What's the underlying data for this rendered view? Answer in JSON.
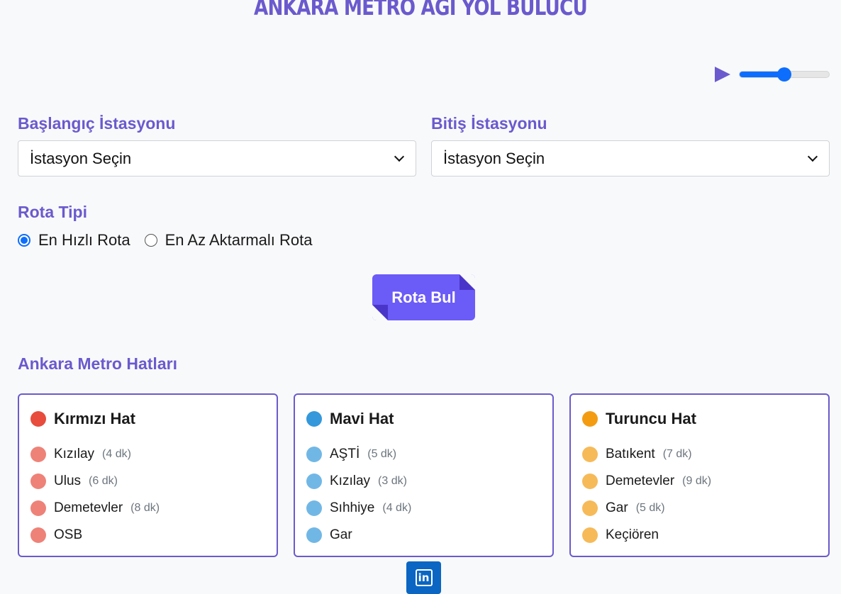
{
  "header": {
    "title": "ANKARA METRO AĞI YOL BULUCU"
  },
  "audio": {
    "icon": "play-icon",
    "volume_fraction": 0.5,
    "accent": "#0d6efd"
  },
  "form": {
    "start_label": "Başlangıç İstasyonu",
    "start_value": "İstasyon Seçin",
    "end_label": "Bitiş İstasyonu",
    "end_value": "İstasyon Seçin",
    "route_type_label": "Rota Tipi",
    "route_options": [
      {
        "label": "En Hızlı Rota",
        "checked": true
      },
      {
        "label": "En Az Aktarmalı Rota",
        "checked": false
      }
    ],
    "submit_label": "Rota Bul"
  },
  "lines": {
    "title": "Ankara Metro Hatları",
    "items": [
      {
        "name": "Kırmızı Hat",
        "color": "#e74c3c",
        "light_color": "#ee8278",
        "stations": [
          {
            "name": "Kızılay",
            "time": "(4 dk)"
          },
          {
            "name": "Ulus",
            "time": "(6 dk)"
          },
          {
            "name": "Demetevler",
            "time": "(8 dk)"
          },
          {
            "name": "OSB",
            "time": ""
          }
        ]
      },
      {
        "name": "Mavi Hat",
        "color": "#3498db",
        "light_color": "#71b7e6",
        "stations": [
          {
            "name": "AŞTİ",
            "time": "(5 dk)"
          },
          {
            "name": "Kızılay",
            "time": "(3 dk)"
          },
          {
            "name": "Sıhhiye",
            "time": "(4 dk)"
          },
          {
            "name": "Gar",
            "time": ""
          }
        ]
      },
      {
        "name": "Turuncu Hat",
        "color": "#f39c12",
        "light_color": "#f6ba59",
        "stations": [
          {
            "name": "Batıkent",
            "time": "(7 dk)"
          },
          {
            "name": "Demetevler",
            "time": "(9 dk)"
          },
          {
            "name": "Gar",
            "time": "(5 dk)"
          },
          {
            "name": "Keçiören",
            "time": ""
          }
        ]
      }
    ]
  },
  "footer": {
    "linkedin_icon": "linkedin-icon",
    "linkedin_text": "in"
  }
}
